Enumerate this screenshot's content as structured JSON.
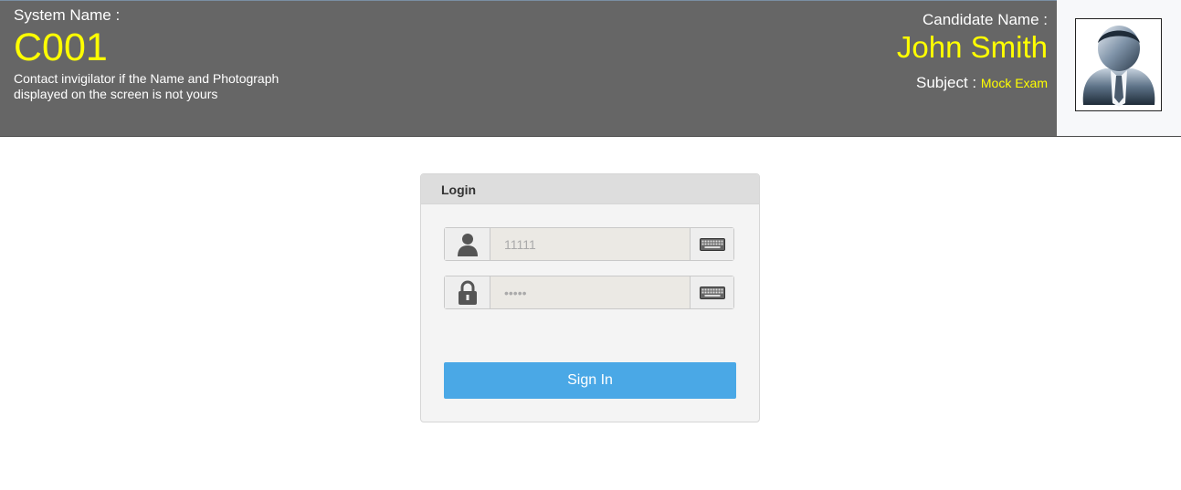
{
  "header": {
    "system_label": "System Name :",
    "system_name": "C001",
    "contact_line1": "Contact invigilator if the Name and Photograph",
    "contact_line2": "displayed on the screen is not yours",
    "candidate_label": "Candidate Name :",
    "candidate_name": "John Smith",
    "subject_label": "Subject :",
    "subject_value": "Mock Exam",
    "colors": {
      "bar": "#666666",
      "highlight": "#ffff00"
    }
  },
  "login": {
    "title": "Login",
    "username": {
      "value": "11111",
      "icon": "user-icon",
      "keyboard_icon": "keyboard-icon"
    },
    "password": {
      "value": "•••••",
      "icon": "lock-icon",
      "keyboard_icon": "keyboard-icon"
    },
    "signin_label": "Sign In",
    "button_color": "#4aa8e6"
  }
}
